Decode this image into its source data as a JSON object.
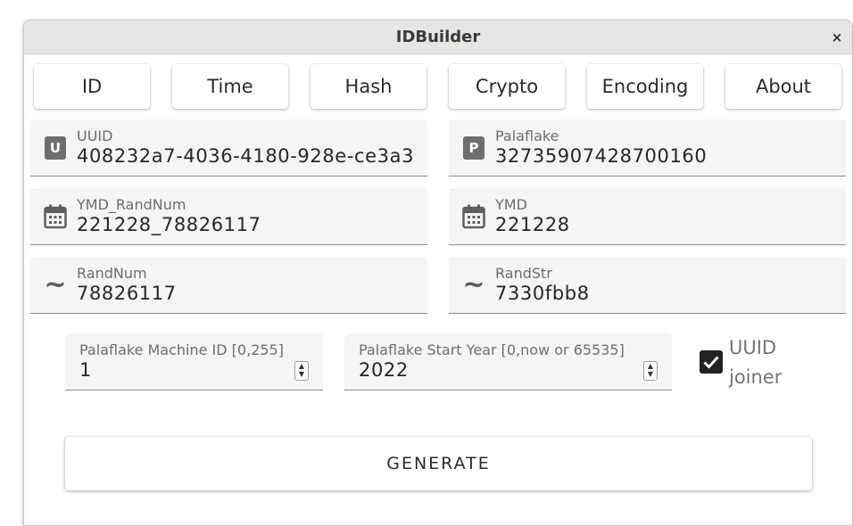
{
  "window": {
    "title": "IDBuilder",
    "close_label": "×"
  },
  "tabs": [
    {
      "label": "ID"
    },
    {
      "label": "Time"
    },
    {
      "label": "Hash"
    },
    {
      "label": "Crypto"
    },
    {
      "label": "Encoding"
    },
    {
      "label": "About"
    }
  ],
  "fields": {
    "uuid": {
      "label": "UUID",
      "value": "408232a7-4036-4180-928e-ce3a3",
      "icon": "uuid-badge-icon",
      "badge": "U"
    },
    "palaflake": {
      "label": "Palaflake",
      "value": "32735907428700160",
      "icon": "palaflake-badge-icon",
      "badge": "P"
    },
    "ymd_randnum": {
      "label": "YMD_RandNum",
      "value": "221228_78826117",
      "icon": "calendar-icon"
    },
    "ymd": {
      "label": "YMD",
      "value": "221228",
      "icon": "calendar-icon"
    },
    "randnum": {
      "label": "RandNum",
      "value": "78826117",
      "icon": "tilde-icon",
      "glyph": "~"
    },
    "randstr": {
      "label": "RandStr",
      "value": "7330fbb8",
      "icon": "tilde-icon",
      "glyph": "~"
    }
  },
  "settings": {
    "machine_id": {
      "label": "Palaflake Machine ID [0,255]",
      "value": "1"
    },
    "start_year": {
      "label": "Palaflake Start Year [0,now or 65535]",
      "value": "2022"
    },
    "uuid_joiner": {
      "label": "UUID joiner",
      "checked": true
    }
  },
  "actions": {
    "generate_label": "GENERATE"
  },
  "colors": {
    "field_bg": "#f5f5f5",
    "titlebar_bg": "#e8e6e3",
    "checkbox": "#222222"
  }
}
